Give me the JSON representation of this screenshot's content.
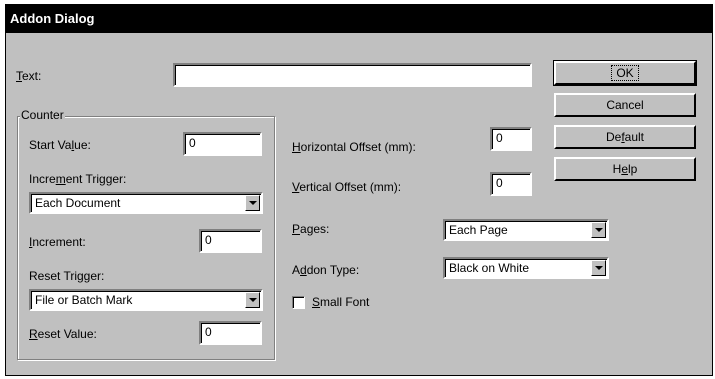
{
  "window": {
    "title": "Addon Dialog"
  },
  "text_field": {
    "label_pre": "",
    "label_u": "T",
    "label_post": "ext:",
    "value": ""
  },
  "buttons": {
    "ok": "OK",
    "cancel": "Cancel",
    "default_pre": "De",
    "default_u": "f",
    "default_post": "ault",
    "help_pre": "H",
    "help_u": "e",
    "help_post": "lp"
  },
  "counter": {
    "group_title": "Counter",
    "start_value": {
      "label_pre": "Start Va",
      "label_u": "l",
      "label_post": "ue:",
      "value": "0"
    },
    "increment_trigger": {
      "label_pre": "Incre",
      "label_u": "m",
      "label_post": "ent Trigger:",
      "selected": "Each Document"
    },
    "increment": {
      "label_pre": "",
      "label_u": "I",
      "label_post": "ncrement:",
      "value": "0"
    },
    "reset_trigger": {
      "label": "Reset Trigger:",
      "selected": "File or Batch Mark"
    },
    "reset_value": {
      "label_pre": "",
      "label_u": "R",
      "label_post": "eset Value:",
      "value": "0"
    }
  },
  "offsets": {
    "horizontal": {
      "label_pre": "",
      "label_u": "H",
      "label_post": "orizontal  Offset (mm):",
      "value": "0"
    },
    "vertical": {
      "label_pre": "",
      "label_u": "V",
      "label_post": "ertical Offset (mm):",
      "value": "0"
    }
  },
  "pages": {
    "label_pre": "",
    "label_u": "P",
    "label_post": "ages:",
    "selected": "Each Page"
  },
  "addon_type": {
    "label_pre": "A",
    "label_u": "d",
    "label_post": "don Type:",
    "selected": "Black on White"
  },
  "small_font": {
    "label_pre": "",
    "label_u": "S",
    "label_post": "mall Font",
    "checked": false
  }
}
